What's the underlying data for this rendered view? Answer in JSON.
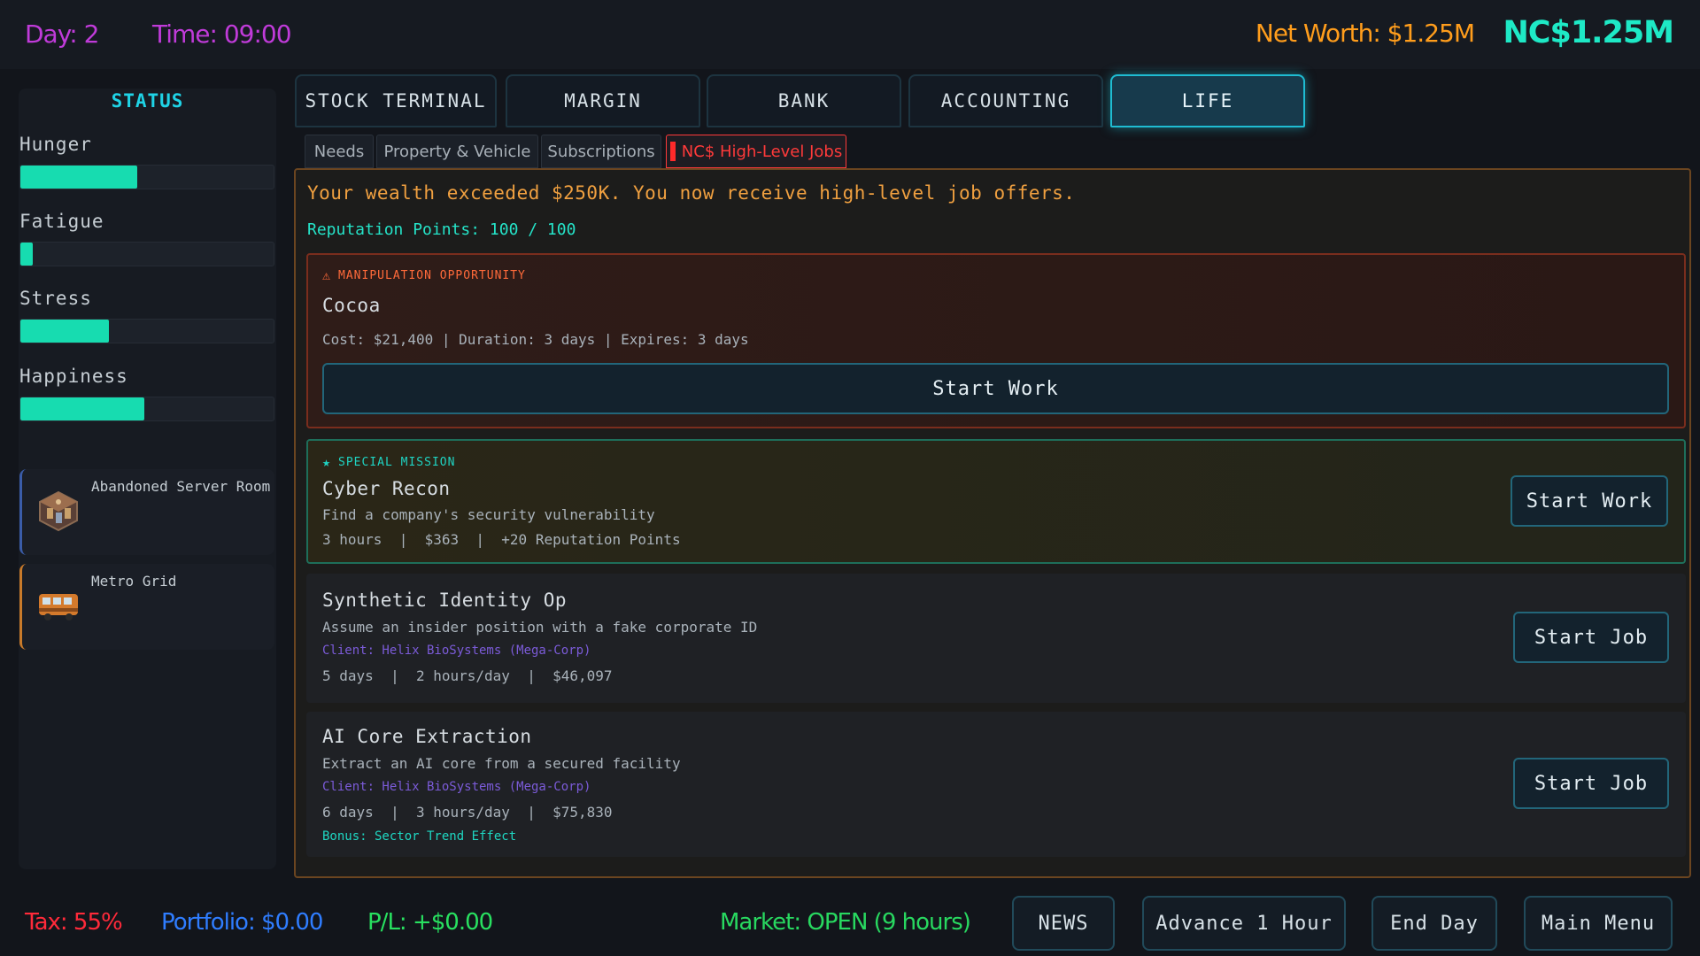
{
  "header": {
    "day": "Day: 2",
    "time": "Time: 09:00",
    "net_worth": "Net Worth: $1.25M",
    "nc_balance": "NC$1.25M"
  },
  "status": {
    "title": "STATUS",
    "bars": [
      {
        "label": "Hunger",
        "value": 0.46
      },
      {
        "label": "Fatigue",
        "value": 0.05
      },
      {
        "label": "Stress",
        "value": 0.35
      },
      {
        "label": "Happiness",
        "value": 0.49
      }
    ],
    "properties": [
      {
        "label": "Abandoned Server Room",
        "icon": "server-room-icon",
        "accent": "#3a5ca8"
      },
      {
        "label": "Metro Grid",
        "icon": "metro-bus-icon",
        "accent": "#c87a2a"
      }
    ]
  },
  "main_tabs": [
    {
      "label": "STOCK TERMINAL",
      "active": false
    },
    {
      "label": "MARGIN",
      "active": false
    },
    {
      "label": "BANK",
      "active": false
    },
    {
      "label": "ACCOUNTING",
      "active": false
    },
    {
      "label": "LIFE",
      "active": true
    }
  ],
  "sub_tabs": [
    {
      "label": "Needs",
      "active": false
    },
    {
      "label": "Property & Vehicle",
      "active": false
    },
    {
      "label": "Subscriptions",
      "active": false
    },
    {
      "label": "NC$ High-Level Jobs",
      "active": true
    }
  ],
  "content": {
    "intro": "Your wealth exceeded $250K. You now receive high-level job offers.",
    "reputation": "Reputation Points: 100 / 100",
    "manipulation": {
      "tag": "MANIPULATION OPPORTUNITY",
      "tag_icon": "warning-icon",
      "title": "Cocoa",
      "details": "Cost: $21,400 | Duration: 3 days | Expires: 3 days",
      "button": "Start Work"
    },
    "special": {
      "tag": "SPECIAL MISSION",
      "tag_icon": "star-icon",
      "title": "Cyber Recon",
      "description": "Find a company's security vulnerability",
      "details": "3 hours  |  $363  |  +20 Reputation Points",
      "button": "Start Work"
    },
    "jobs": [
      {
        "title": "Synthetic Identity Op",
        "description": "Assume an insider position with a fake corporate ID",
        "client": "Client: Helix BioSystems (Mega-Corp)",
        "details": "5 days  |  2 hours/day  |  $46,097",
        "bonus": "",
        "button": "Start Job"
      },
      {
        "title": "AI Core Extraction",
        "description": "Extract an AI core from a secured facility",
        "client": "Client: Helix BioSystems (Mega-Corp)",
        "details": "6 days  |  3 hours/day  |  $75,830",
        "bonus": "Bonus: Sector Trend Effect",
        "button": "Start Job"
      }
    ]
  },
  "footer": {
    "tax": "Tax: 55%",
    "portfolio": "Portfolio: $0.00",
    "pl": "P/L: +$0.00",
    "market": "Market: OPEN (9 hours)",
    "news_button": "NEWS",
    "advance_button": "Advance 1 Hour",
    "end_day_button": "End Day",
    "main_menu_button": "Main Menu"
  },
  "colors": {
    "accent_cyan": "#1fbcd2",
    "accent_orange": "#f0a040",
    "danger_red": "#ff3a3a",
    "bar_green": "#17dcb0",
    "tax_red": "#ff2a3a",
    "portfolio_blue": "#2f7dff",
    "pl_green": "#28e060",
    "market_green": "#28d860"
  }
}
